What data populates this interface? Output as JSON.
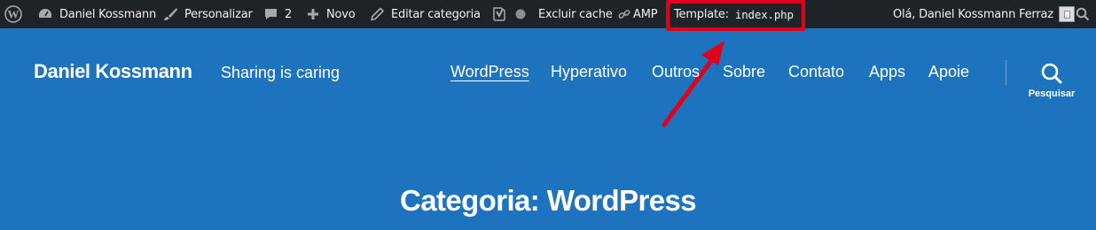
{
  "adminbar": {
    "wp_logo": "wordpress-icon",
    "site_name": "Daniel Kossmann",
    "customize": "Personalizar",
    "comments_count": "2",
    "new": "Novo",
    "edit_category": "Editar categoria",
    "clear_cache": "Excluir cache",
    "amp": "AMP",
    "template_label": "Template:",
    "template_file": "index.php",
    "greeting": "Olá, Daniel Kossmann Ferraz"
  },
  "header": {
    "site_title": "Daniel Kossmann",
    "site_description": "Sharing is caring",
    "menu": [
      "WordPress",
      "Hyperativo",
      "Outros",
      "Sobre",
      "Contato",
      "Apps",
      "Apoie"
    ],
    "search_label": "Pesquisar"
  },
  "archive": {
    "title": "Categoria: WordPress"
  },
  "colors": {
    "adminbar_bg": "#1d2327",
    "header_bg": "#1e73be",
    "highlight": "#e0001b"
  }
}
